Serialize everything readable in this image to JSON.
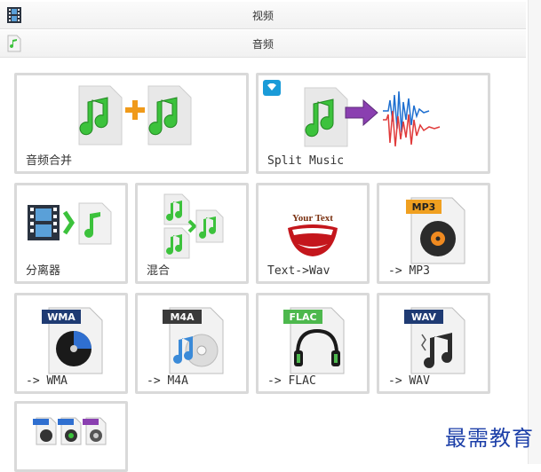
{
  "header": {
    "video_label": "视频",
    "audio_label": "音频"
  },
  "tiles": [
    {
      "label": "音频合并"
    },
    {
      "label": "Split Music"
    },
    {
      "label": "分离器"
    },
    {
      "label": "混合"
    },
    {
      "label": "Text->Wav"
    },
    {
      "label": "-> MP3"
    },
    {
      "label": "-> WMA"
    },
    {
      "label": "-> M4A"
    },
    {
      "label": "-> FLAC"
    },
    {
      "label": "-> WAV"
    },
    {
      "label": ""
    }
  ],
  "badges": {
    "mp3": "MP3",
    "wma": "WMA",
    "m4a": "M4A",
    "flac": "FLAC",
    "wav": "WAV",
    "your_text": "Your Text"
  },
  "watermark": "最需教育",
  "colors": {
    "tile_border": "#d9d9d9",
    "note_green": "#3cc23c",
    "mp3_badge": "#f0a020",
    "flac_badge": "#4db84d",
    "wma_badge": "#1f3b73",
    "m4a_badge": "#3a3a3a",
    "wav_badge": "#1f3b73",
    "watermark": "#1c3fa8"
  }
}
